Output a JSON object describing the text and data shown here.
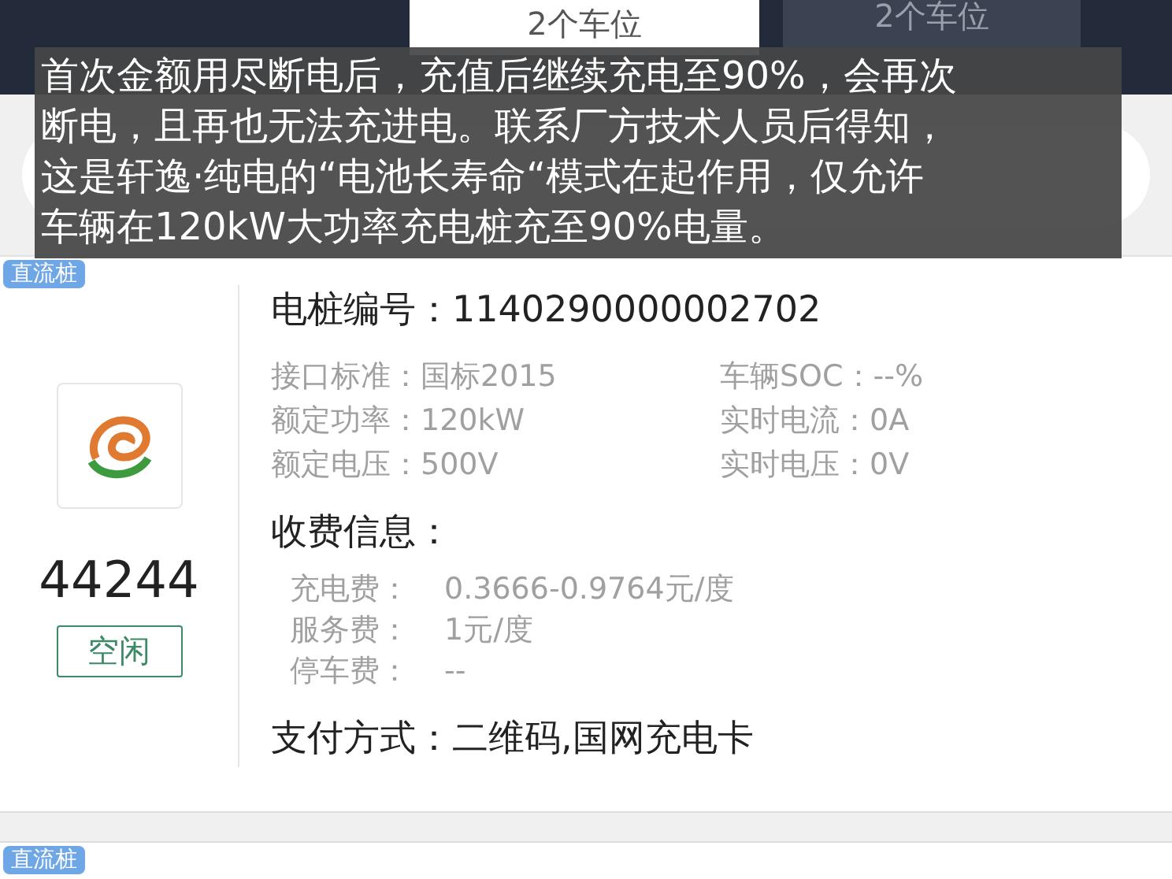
{
  "tabs": [
    {
      "label": "2个车位",
      "selected": true
    },
    {
      "label": "2个车位",
      "selected": false
    }
  ],
  "caption_lines": [
    "首次金额用尽断电后，充值后继续充电至90%，会再次",
    "断电，且再也无法充进电。联系厂方技术人员后得知，",
    "这是轩逸·纯电的“电池长寿命“模式在起作用，仅允许",
    "车辆在120kW大功率充电桩充至90%电量。"
  ],
  "stations": [
    {
      "tag": "直流桩",
      "number": "44244",
      "status": "空闲",
      "pile_id_label": "电桩编号：",
      "pile_id": "1140290000002702",
      "specs": [
        {
          "label": "接口标准：",
          "value": "国标2015"
        },
        {
          "label": "车辆SOC：",
          "value": "--%"
        },
        {
          "label": "额定功率：",
          "value": "120kW"
        },
        {
          "label": "实时电流：",
          "value": "0A"
        },
        {
          "label": "额定电压：",
          "value": "500V"
        },
        {
          "label": "实时电压：",
          "value": "0V"
        }
      ],
      "fees_title": "收费信息：",
      "fees": [
        {
          "label": "充电费：",
          "value": "0.3666-0.9764元/度"
        },
        {
          "label": "服务费：",
          "value": "1元/度"
        },
        {
          "label": "停车费：",
          "value": "--"
        }
      ],
      "payment_label": "支付方式：",
      "payment": "二维码,国网充电卡"
    }
  ],
  "next_tag": "直流桩"
}
